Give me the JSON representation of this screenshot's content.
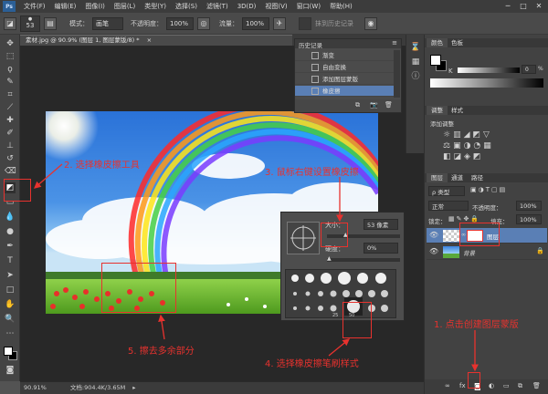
{
  "menubar": {
    "logo": "Ps",
    "items": [
      "文件(F)",
      "编辑(E)",
      "图像(I)",
      "图层(L)",
      "类型(Y)",
      "选择(S)",
      "滤镜(T)",
      "3D(D)",
      "视图(V)",
      "窗口(W)",
      "帮助(H)"
    ],
    "minimize": "─",
    "maximize": "□",
    "close": "✕"
  },
  "options": {
    "brush_size": "53",
    "mode_label": "模式：",
    "mode_value": "画笔",
    "opacity_label": "不透明度：",
    "opacity_value": "100%",
    "flow_label": "流量：",
    "flow_value": "100%",
    "history_label": "抹到历史记录"
  },
  "document": {
    "tab_title": "素材.jpg @ 90.9% (图层 1, 图层蒙版/8) *",
    "tab_close": "×",
    "status_zoom": "90.91%",
    "status_doc": "文档:904.4K/3.65M"
  },
  "history_panel": {
    "title": "历史记录",
    "items": [
      "渐变",
      "自由变换",
      "添加图层蒙版",
      "橡皮擦"
    ]
  },
  "brush_popup": {
    "size_label": "大小：",
    "size_value": "53 像素",
    "hardness_label": "硬度：",
    "hardness_value": "0%",
    "preset_sizes": [
      "25",
      "50"
    ]
  },
  "right_panel": {
    "color_tabs": [
      "颜色",
      "色板"
    ],
    "channel_k": "K",
    "channel_value": "0",
    "channel_unit": "%",
    "adjust_tabs": [
      "调整",
      "样式"
    ],
    "adjust_title": "添加调整",
    "layers_tabs": [
      "图层",
      "通道",
      "路径"
    ],
    "kind_label": "ρ 类型",
    "blend_mode": "正常",
    "opacity_label": "不透明度：",
    "opacity_value": "100%",
    "lock_label": "锁定：",
    "fill_label": "填充：",
    "fill_value": "100%",
    "layers": [
      {
        "name": "图层",
        "selected": true
      },
      {
        "name": "背景",
        "selected": false
      }
    ]
  },
  "annotations": {
    "a1": "1. 点击创建图层蒙版",
    "a2": "2. 选择橡皮擦工具",
    "a3": "3. 鼠标右键设置橡皮擦",
    "a4": "4. 选择橡皮擦笔刷样式",
    "a5": "5. 擦去多余部分"
  },
  "colors": {
    "annotation": "#e8322e",
    "panel_bg": "#424242",
    "selection": "#5a7fb5"
  }
}
